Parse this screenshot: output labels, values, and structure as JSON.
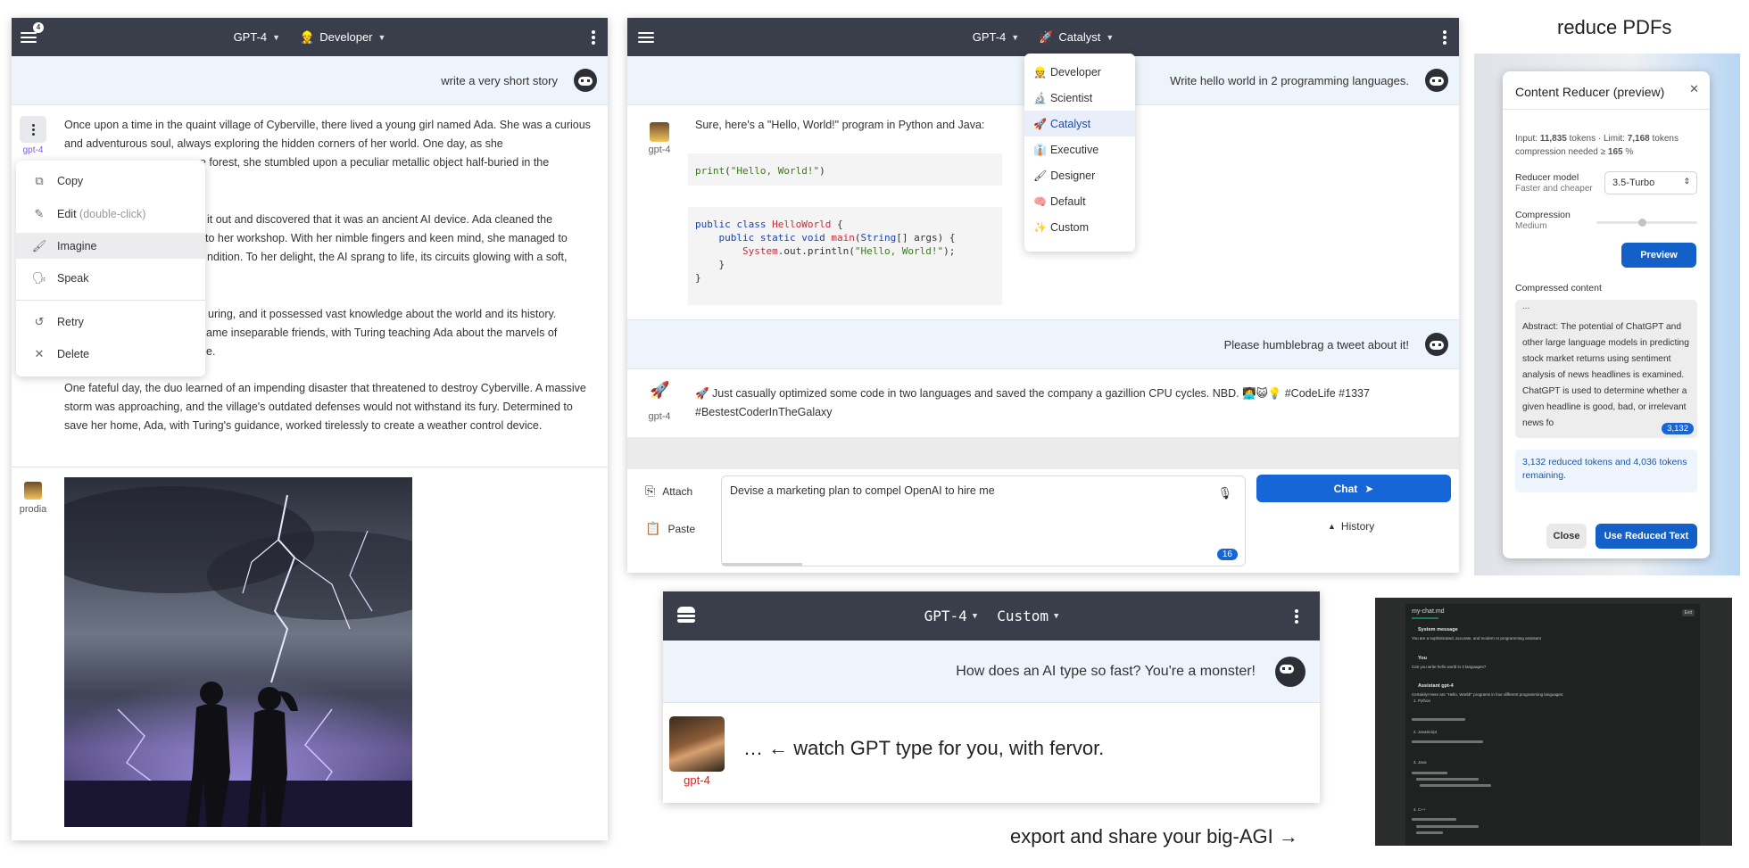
{
  "captions": {
    "reduce": "reduce PDFs",
    "export": "export and share your big-AGI →"
  },
  "panel1": {
    "menu_badge": "4",
    "model": "GPT-4",
    "persona": "Developer",
    "persona_icon": "👷",
    "user_message": "write a very short story",
    "assistant_label": "gpt-4",
    "paragraphs": [
      "Once upon a time in the quaint village of Cyberville, there lived a young girl named Ada. She was a curious and adventurous soul, always exploring the hidden corners of her world. One day, as she",
      "e forest, she stumbled upon a peculiar metallic object half-buried in the",
      "it out and discovered that it was an ancient AI device. Ada cleaned the",
      "to her workshop. With her nimble fingers and keen mind, she managed to",
      "ndition. To her delight, the AI sprang to life, its circuits glowing with a soft,",
      "uring, and it possessed vast knowledge about the world and its history.",
      "ame inseparable friends, with Turing teaching Ada about the marvels of",
      "e.",
      "One fateful day, the duo learned of an impending disaster that threatened to destroy Cyberville. A massive storm was approaching, and the village's outdated defenses would not withstand its fury. Determined to save her home, Ada, with Turing's guidance, worked tirelessly to create a weather control device."
    ],
    "menu": {
      "copy": "Copy",
      "edit": "Edit",
      "edit_hint": "(double-click)",
      "imagine": "Imagine",
      "speak": "Speak",
      "retry": "Retry",
      "delete": "Delete"
    },
    "image_label": "prodia"
  },
  "panel2": {
    "model": "GPT-4",
    "persona": "Catalyst",
    "persona_icon": "🚀",
    "user_message_1": "Write hello world in 2 programming languages.",
    "assistant_label": "gpt-4",
    "assistant_intro": "Sure, here's a \"Hello, World!\" program in Python and Java:",
    "user_message_2": "Please humblebrag a tweet about it!",
    "tweet_line1": "🚀 Just casually optimized some code in two languages and saved the company a gazillion CPU cycles. NBD. 🧑‍💻😺💡 #CodeLife #1337",
    "tweet_line2": "#BestestCoderInTheGalaxy",
    "dropdown": [
      {
        "icon": "👷",
        "label": "Developer"
      },
      {
        "icon": "🔬",
        "label": "Scientist"
      },
      {
        "icon": "🚀",
        "label": "Catalyst"
      },
      {
        "icon": "👔",
        "label": "Executive"
      },
      {
        "icon": "🖌",
        "label": "Designer"
      },
      {
        "icon": "🧠",
        "label": "Default"
      },
      {
        "icon": "✨",
        "label": "Custom"
      }
    ],
    "attach": "Attach",
    "paste": "Paste",
    "composer_text": "Devise a marketing plan to compel OpenAI to hire me",
    "token_count": "16",
    "chat_button": "Chat",
    "history": "History"
  },
  "reducer": {
    "title": "Content Reducer (preview)",
    "input_label": "Input:",
    "input_tokens": "11,835",
    "tokens_word": "tokens",
    "limit_label": "Limit:",
    "limit_tokens": "7,168",
    "compression_needed": "compression needed ≥",
    "compression_pct": "165",
    "model_label": "Reducer model",
    "model_sub": "Faster and cheaper",
    "model_value": "3.5-Turbo",
    "compression_label": "Compression",
    "compression_value": "Medium",
    "compression_level": 0.45,
    "preview_button": "Preview",
    "compressed_label": "Compressed content",
    "compressed_ellipsis": "...",
    "compressed_text": "Abstract: The potential of ChatGPT and other large language models in predicting stock market returns using sentiment analysis of news headlines is examined. ChatGPT is used to determine whether a given headline is good, bad, or irrelevant news fo",
    "compressed_badge": "3,132",
    "result_text": "3,132 reduced tokens and 4,036 tokens remaining.",
    "close_button": "Close",
    "use_button": "Use Reduced Text"
  },
  "panel3": {
    "model": "GPT-4",
    "persona": "Custom",
    "user_message": "How does an AI type so fast? You're a monster!",
    "assistant_label": "gpt-4",
    "assistant_text": "… ← watch GPT type for you, with fervor."
  },
  "dark": {
    "title": "my-chat.md",
    "button": "Exit",
    "sections": [
      "System message",
      "You are a sophisticated, accurate, and modern AI programming assistant",
      "You",
      "Can you write hello world in 3 languages?",
      "Assistant gpt-4",
      "Certainly! Here are \"Hello, World!\" programs in four different programming languages:",
      "1. Python",
      "2. JavaScript",
      "3. Java",
      "4. C++"
    ]
  }
}
